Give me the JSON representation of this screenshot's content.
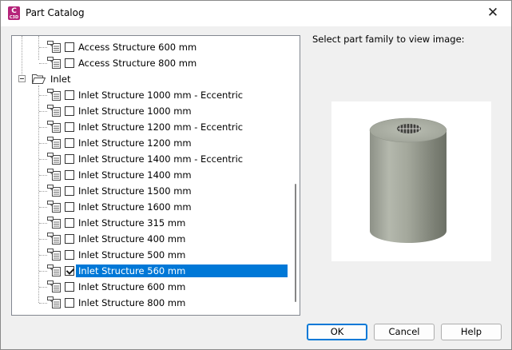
{
  "window": {
    "title": "Part Catalog",
    "app_icon": {
      "letter": "C",
      "sub": "C3D"
    },
    "close_glyph": "✕"
  },
  "tree": {
    "items": [
      {
        "label": "Access Structure 600 mm",
        "checked": false,
        "selected": false
      },
      {
        "label": "Access Structure 800 mm",
        "checked": false,
        "selected": false
      },
      {
        "label": "Inlet",
        "type": "folder",
        "expanded": true
      },
      {
        "label": "Inlet Structure 1000 mm - Eccentric",
        "checked": false,
        "selected": false
      },
      {
        "label": "Inlet Structure 1000 mm",
        "checked": false,
        "selected": false
      },
      {
        "label": "Inlet Structure 1200 mm - Eccentric",
        "checked": false,
        "selected": false
      },
      {
        "label": "Inlet Structure 1200 mm",
        "checked": false,
        "selected": false
      },
      {
        "label": "Inlet Structure 1400 mm - Eccentric",
        "checked": false,
        "selected": false
      },
      {
        "label": "Inlet Structure 1400 mm",
        "checked": false,
        "selected": false
      },
      {
        "label": "Inlet Structure 1500 mm",
        "checked": false,
        "selected": false
      },
      {
        "label": "Inlet Structure 1600 mm",
        "checked": false,
        "selected": false
      },
      {
        "label": "Inlet Structure 315 mm",
        "checked": false,
        "selected": false
      },
      {
        "label": "Inlet Structure 400 mm",
        "checked": false,
        "selected": false
      },
      {
        "label": "Inlet Structure 500 mm",
        "checked": false,
        "selected": false
      },
      {
        "label": "Inlet Structure 560 mm",
        "checked": true,
        "selected": true
      },
      {
        "label": "Inlet Structure 600 mm",
        "checked": false,
        "selected": false
      },
      {
        "label": "Inlet Structure 800 mm",
        "checked": false,
        "selected": false
      }
    ]
  },
  "preview": {
    "prompt": "Select part family to view image:",
    "image": "cylindrical-concrete-inlet-structure"
  },
  "buttons": {
    "ok": "OK",
    "cancel": "Cancel",
    "help": "Help"
  },
  "colors": {
    "selection": "#0078d7",
    "app_icon": "#b5247a",
    "concrete": "#9da195"
  }
}
